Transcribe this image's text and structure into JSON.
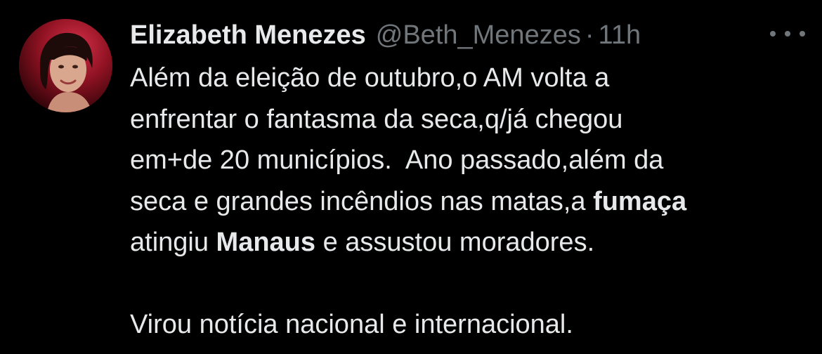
{
  "author": {
    "name": "Elizabeth Menezes",
    "handle": "@Beth_Menezes",
    "separator": "·",
    "time": "11h",
    "avatar_icon": "profile-photo"
  },
  "menu_icon": "more-options-icon",
  "tweet": {
    "line1": "Além da eleição de outubro,o AM volta a",
    "line2": "enfrentar o fantasma da seca,q/já chegou",
    "line3": "em+de 20 municípios.  Ano passado,além da",
    "line4_pre": "seca e grandes incêndios nas matas,a ",
    "line4_bold": "fumaça",
    "line5_pre": "atingiu ",
    "line5_bold": "Manaus",
    "line5_post": " e assustou moradores.",
    "line7": "Virou notícia nacional e internacional."
  },
  "colors": {
    "background": "#000000",
    "primary_text": "#e7e9ea",
    "secondary_text": "#71767b"
  }
}
